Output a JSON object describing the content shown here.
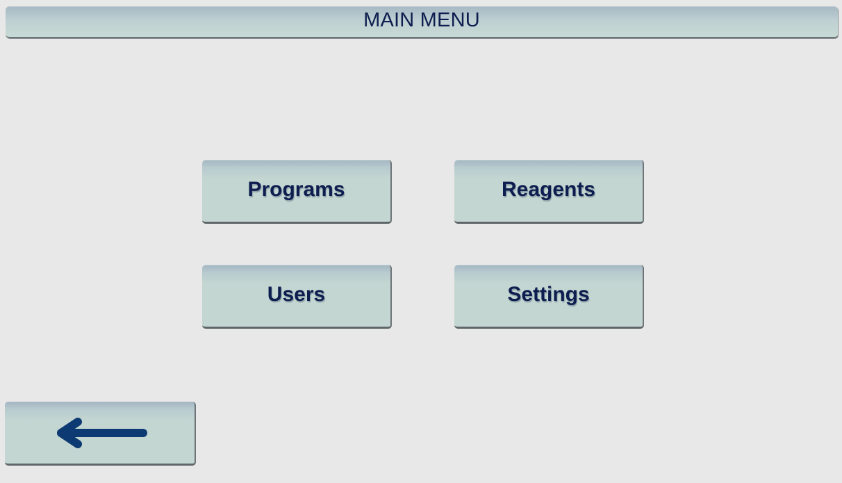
{
  "header": {
    "title": "MAIN MENU"
  },
  "menu": {
    "programs_label": "Programs",
    "reagents_label": "Reagents",
    "users_label": "Users",
    "settings_label": "Settings"
  },
  "footer": {
    "back_icon": "arrow-left-icon"
  },
  "colors": {
    "background": "#e8e8e8",
    "button_face": "#c3d6d1",
    "text": "#0d1d4f",
    "arrow": "#0d3a72"
  }
}
